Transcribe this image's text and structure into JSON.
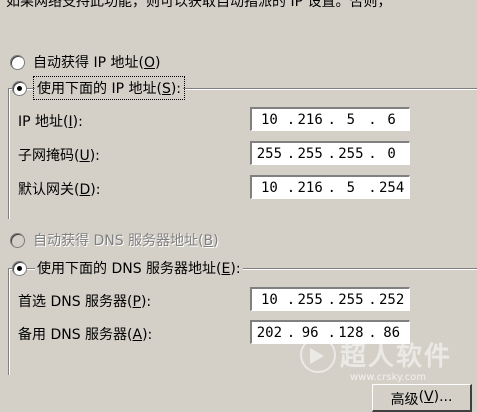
{
  "top_cutoff_text": "如果网络支持此功能，则可以获取自动指派的 IP 设置。否则，",
  "ip_auto_radio": {
    "label": "自动获得 IP 地址",
    "hotkey": "O",
    "checked": false
  },
  "ip_manual_radio": {
    "label": "使用下面的 IP 地址",
    "hotkey": "S",
    "checked": true
  },
  "ip_fields": [
    {
      "label": "IP 地址",
      "hotkey": "I",
      "octets": [
        "10",
        "216",
        "5",
        "6"
      ]
    },
    {
      "label": "子网掩码",
      "hotkey": "U",
      "octets": [
        "255",
        "255",
        "255",
        "0"
      ]
    },
    {
      "label": "默认网关",
      "hotkey": "D",
      "octets": [
        "10",
        "216",
        "5",
        "254"
      ]
    }
  ],
  "dns_auto_radio": {
    "label": "自动获得 DNS 服务器地址",
    "hotkey": "B",
    "checked": false,
    "disabled": true
  },
  "dns_manual_radio": {
    "label": "使用下面的 DNS 服务器地址",
    "hotkey": "E",
    "checked": true
  },
  "dns_fields": [
    {
      "label": "首选 DNS 服务器",
      "hotkey": "P",
      "octets": [
        "10",
        "255",
        "255",
        "252"
      ]
    },
    {
      "label": "备用 DNS 服务器",
      "hotkey": "A",
      "octets": [
        "202",
        "96",
        "128",
        "86"
      ]
    }
  ],
  "advanced_button": {
    "label": "高级",
    "hotkey": "V",
    "suffix": "..."
  },
  "watermark": {
    "text": "超人软件",
    "url": "www.crsky.com"
  }
}
